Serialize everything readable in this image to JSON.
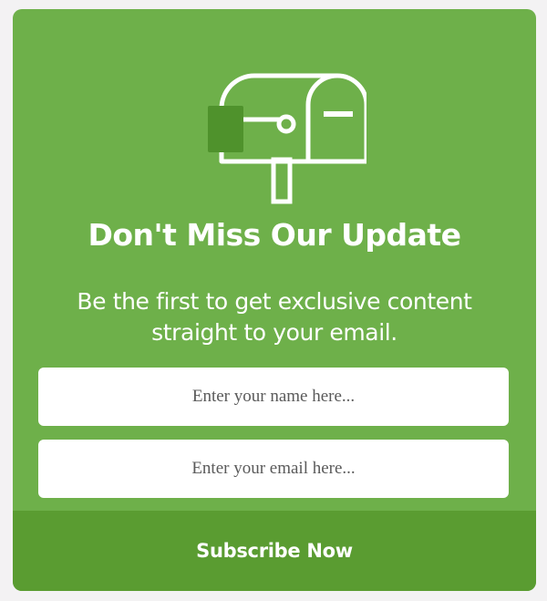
{
  "card": {
    "background": "#6eb04a",
    "accent": "#5a9c31",
    "icon": "mailbox-icon"
  },
  "headline": "Don't Miss Our Update",
  "subtext": {
    "line1": "Be the first to get exclusive content",
    "line2": "straight to your email."
  },
  "form": {
    "name_placeholder": "Enter your name here...",
    "email_placeholder": "Enter your email here...",
    "submit_label": "Subscribe Now"
  }
}
